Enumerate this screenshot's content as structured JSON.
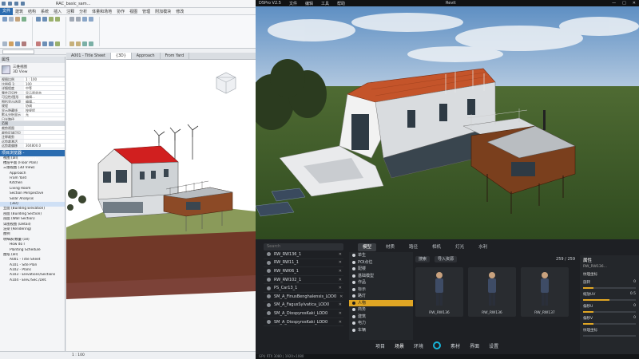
{
  "revit": {
    "doc_title": "RAC_basic_sam...",
    "menu": [
      "文件",
      "建筑",
      "结构",
      "系统",
      "插入",
      "注释",
      "分析",
      "体量和场地",
      "协作",
      "视图",
      "管理",
      "附加模块",
      "修改"
    ],
    "active_menu_index": 0,
    "type_selector": {
      "line1": "三维视图",
      "line2": "3D View"
    },
    "properties_header": "属性",
    "props": [
      {
        "k": "视图比例",
        "v": "1 : 100"
      },
      {
        "k": "比例值 1:",
        "v": "100"
      },
      {
        "k": "详细程度",
        "v": "中等"
      },
      {
        "k": "零件可见性",
        "v": "显示原状态"
      },
      {
        "k": "可见性/图形",
        "v": "编辑..."
      },
      {
        "k": "图形显示选项",
        "v": "编辑..."
      },
      {
        "k": "规程",
        "v": "协调"
      },
      {
        "k": "显示隐藏线",
        "v": "按规程"
      },
      {
        "k": "默认分析显示",
        "v": "无"
      },
      {
        "k": "日光路径",
        "v": ""
      }
    ],
    "props_section": "范围",
    "props2": [
      {
        "k": "裁剪视图",
        "v": ""
      },
      {
        "k": "裁剪区域可见",
        "v": ""
      },
      {
        "k": "注释裁剪",
        "v": ""
      },
      {
        "k": "远剪裁激活",
        "v": ""
      },
      {
        "k": "远剪裁偏移",
        "v": "304800.0"
      }
    ],
    "browser_header": "项目浏览器 - RAC_basic_sample...",
    "browser_items": [
      "视图 (all)",
      "楼层平面 (Floor Plan)",
      "三维视图 (3D View)",
      "Approach",
      "From Yard",
      "Kitchen",
      "Living Room",
      "Section Perspective",
      "Solar Analysis",
      "{3D}",
      "立面 (Building Elevation)",
      "剖面 (Building Section)",
      "剖面 (Wall Section)",
      "详图视图 (Detail)",
      "渲染 (Rendering)",
      "图例",
      "明细表/数量 (all)",
      "How do I",
      "Planting Schedule",
      "图纸 (all)",
      "A001 - Title Sheet",
      "A101 - Site Plan",
      "A102 - Plans",
      "A103 - Elevations/Sections",
      "A104 - Elev./Sec./Det."
    ],
    "browser_selected": 9,
    "view_tabs": [
      "A001 - Title Sheet",
      "{3D}",
      "Approach",
      "From Yard"
    ],
    "active_view_tab": 1,
    "status": "1 : 100"
  },
  "render": {
    "app_name": "D5Pro V2.5",
    "menu": [
      "文件",
      "编辑",
      "工具",
      "帮助"
    ],
    "window_title": "Revit",
    "search_placeholder": "Search",
    "layers": [
      "RW_RW136_1",
      "RW_RW11_1",
      "RW_RW06_1",
      "RW_RW102_1",
      "PS_Car13_1",
      "SM_A_FinusBenghalensis_LOD0",
      "SM_A_FagusSylvatica_LOD0",
      "SM_A_DiospyrosKaki_LOD0",
      "SM_A_DiospyrosKaki_LOD0"
    ],
    "resource_tabs": [
      "模型",
      "材质",
      "路径",
      "相机",
      "灯光",
      "水利"
    ],
    "active_resource_tab": 0,
    "categories": [
      "单生",
      "POI点位",
      "配楼",
      "基础模型",
      "作品",
      "标示",
      "路灯",
      "人物",
      "商务",
      "建筑",
      "电力",
      "车辆"
    ],
    "selected_category": 7,
    "assets_toolbar": {
      "search": "搜索",
      "import": "导入资源",
      "count": "259 / 259"
    },
    "assets": [
      "RW_RW136",
      "RW_RW136",
      "RW_RW137"
    ],
    "attr_title": "属性",
    "attr_sub": "RW_RW136...",
    "attr_section": "纹理坐标",
    "attr_rows": [
      {
        "k": "旋转",
        "v": "0"
      },
      {
        "k": "缩放UV",
        "v": "0.5"
      },
      {
        "k": "偏移U",
        "v": "0"
      },
      {
        "k": "偏移V",
        "v": "0"
      },
      {
        "k": "纹理坐标",
        "v": ""
      }
    ],
    "attr_levels": [
      0.2,
      0.5,
      0.2,
      0.2,
      0.0
    ],
    "dock": [
      "项目",
      "场景",
      "环境",
      "素材",
      "界面",
      "设置"
    ],
    "active_dock": 1,
    "status": "GPU RTX 3080 | 1920×1080"
  }
}
